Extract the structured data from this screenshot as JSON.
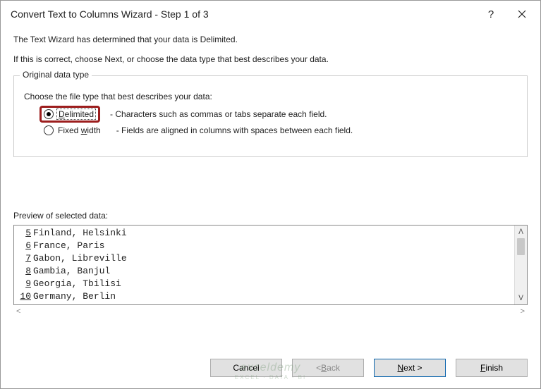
{
  "titlebar": {
    "title": "Convert Text to Columns Wizard - Step 1 of 3",
    "help": "?",
    "close": "×"
  },
  "intro": {
    "line1": "The Text Wizard has determined that your data is Delimited.",
    "line2": "If this is correct, choose Next, or choose the data type that best describes your data."
  },
  "fieldset": {
    "legend": "Original data type",
    "choose": "Choose the file type that best describes your data:",
    "delimited_label": "Delimited",
    "delimited_desc": "- Characters such as commas or tabs separate each field.",
    "fixed_label": "Fixed width",
    "fixed_desc": "- Fields are aligned in columns with spaces between each field."
  },
  "preview": {
    "label": "Preview of selected data:",
    "rows": [
      {
        "n": "5",
        "text": "Finland, Helsinki"
      },
      {
        "n": "6",
        "text": "France, Paris"
      },
      {
        "n": "7",
        "text": "Gabon, Libreville"
      },
      {
        "n": "8",
        "text": "Gambia, Banjul"
      },
      {
        "n": "9",
        "text": "Georgia, Tbilisi"
      },
      {
        "n": "10",
        "text": "Germany, Berlin"
      }
    ]
  },
  "buttons": {
    "cancel": "Cancel",
    "back": "< Back",
    "next": "Next >",
    "finish": "Finish"
  },
  "watermark": {
    "main": "exceldemy",
    "sub": "EXCEL · DATA · BI"
  }
}
